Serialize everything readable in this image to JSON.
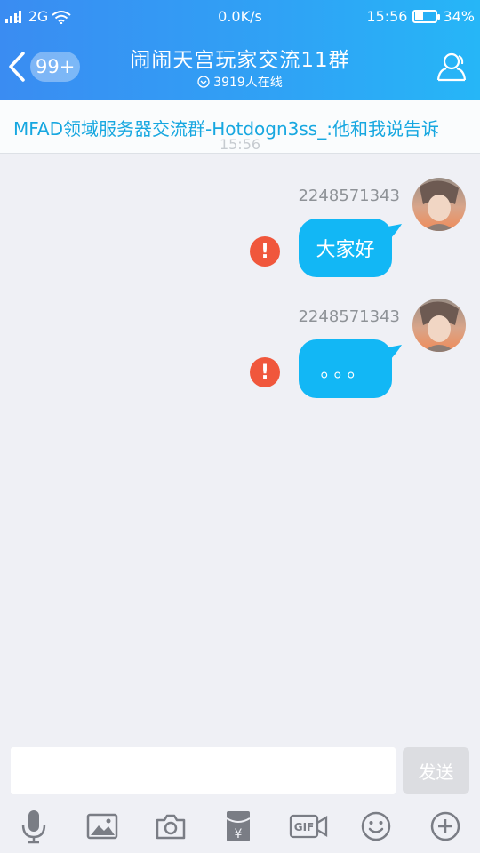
{
  "status_bar": {
    "sim": "2",
    "network": "2G",
    "speed": "0.0K/s",
    "time": "15:56",
    "battery": "34%",
    "battery_level": 0.34
  },
  "header": {
    "unread_badge": "99+",
    "title": "闹闹天宫玩家交流11群",
    "online": "3919人在线"
  },
  "announcement": {
    "text": "MFAD领域服务器交流群-Hotdogn3ss_:他和我说告诉"
  },
  "chat": {
    "timestamp": "15:56",
    "messages": [
      {
        "sender": "2248571343",
        "text": "大家好",
        "failed_icon": "!"
      },
      {
        "sender": "2248571343",
        "text": "。。。",
        "failed_icon": "!"
      }
    ]
  },
  "input": {
    "value": "",
    "placeholder": "",
    "send_label": "发送"
  },
  "toolbar": {
    "items": [
      "mic-icon",
      "image-icon",
      "camera-icon",
      "red-packet-icon",
      "gif-icon",
      "emoji-icon",
      "plus-icon"
    ],
    "red_packet_symbol": "¥",
    "gif_label": "GIF"
  },
  "colors": {
    "header_start": "#3a8cf2",
    "header_end": "#26b6f7",
    "bubble": "#12b7f5",
    "error": "#f0573c",
    "background": "#eff0f5",
    "announcement_text": "#17a7e0"
  }
}
